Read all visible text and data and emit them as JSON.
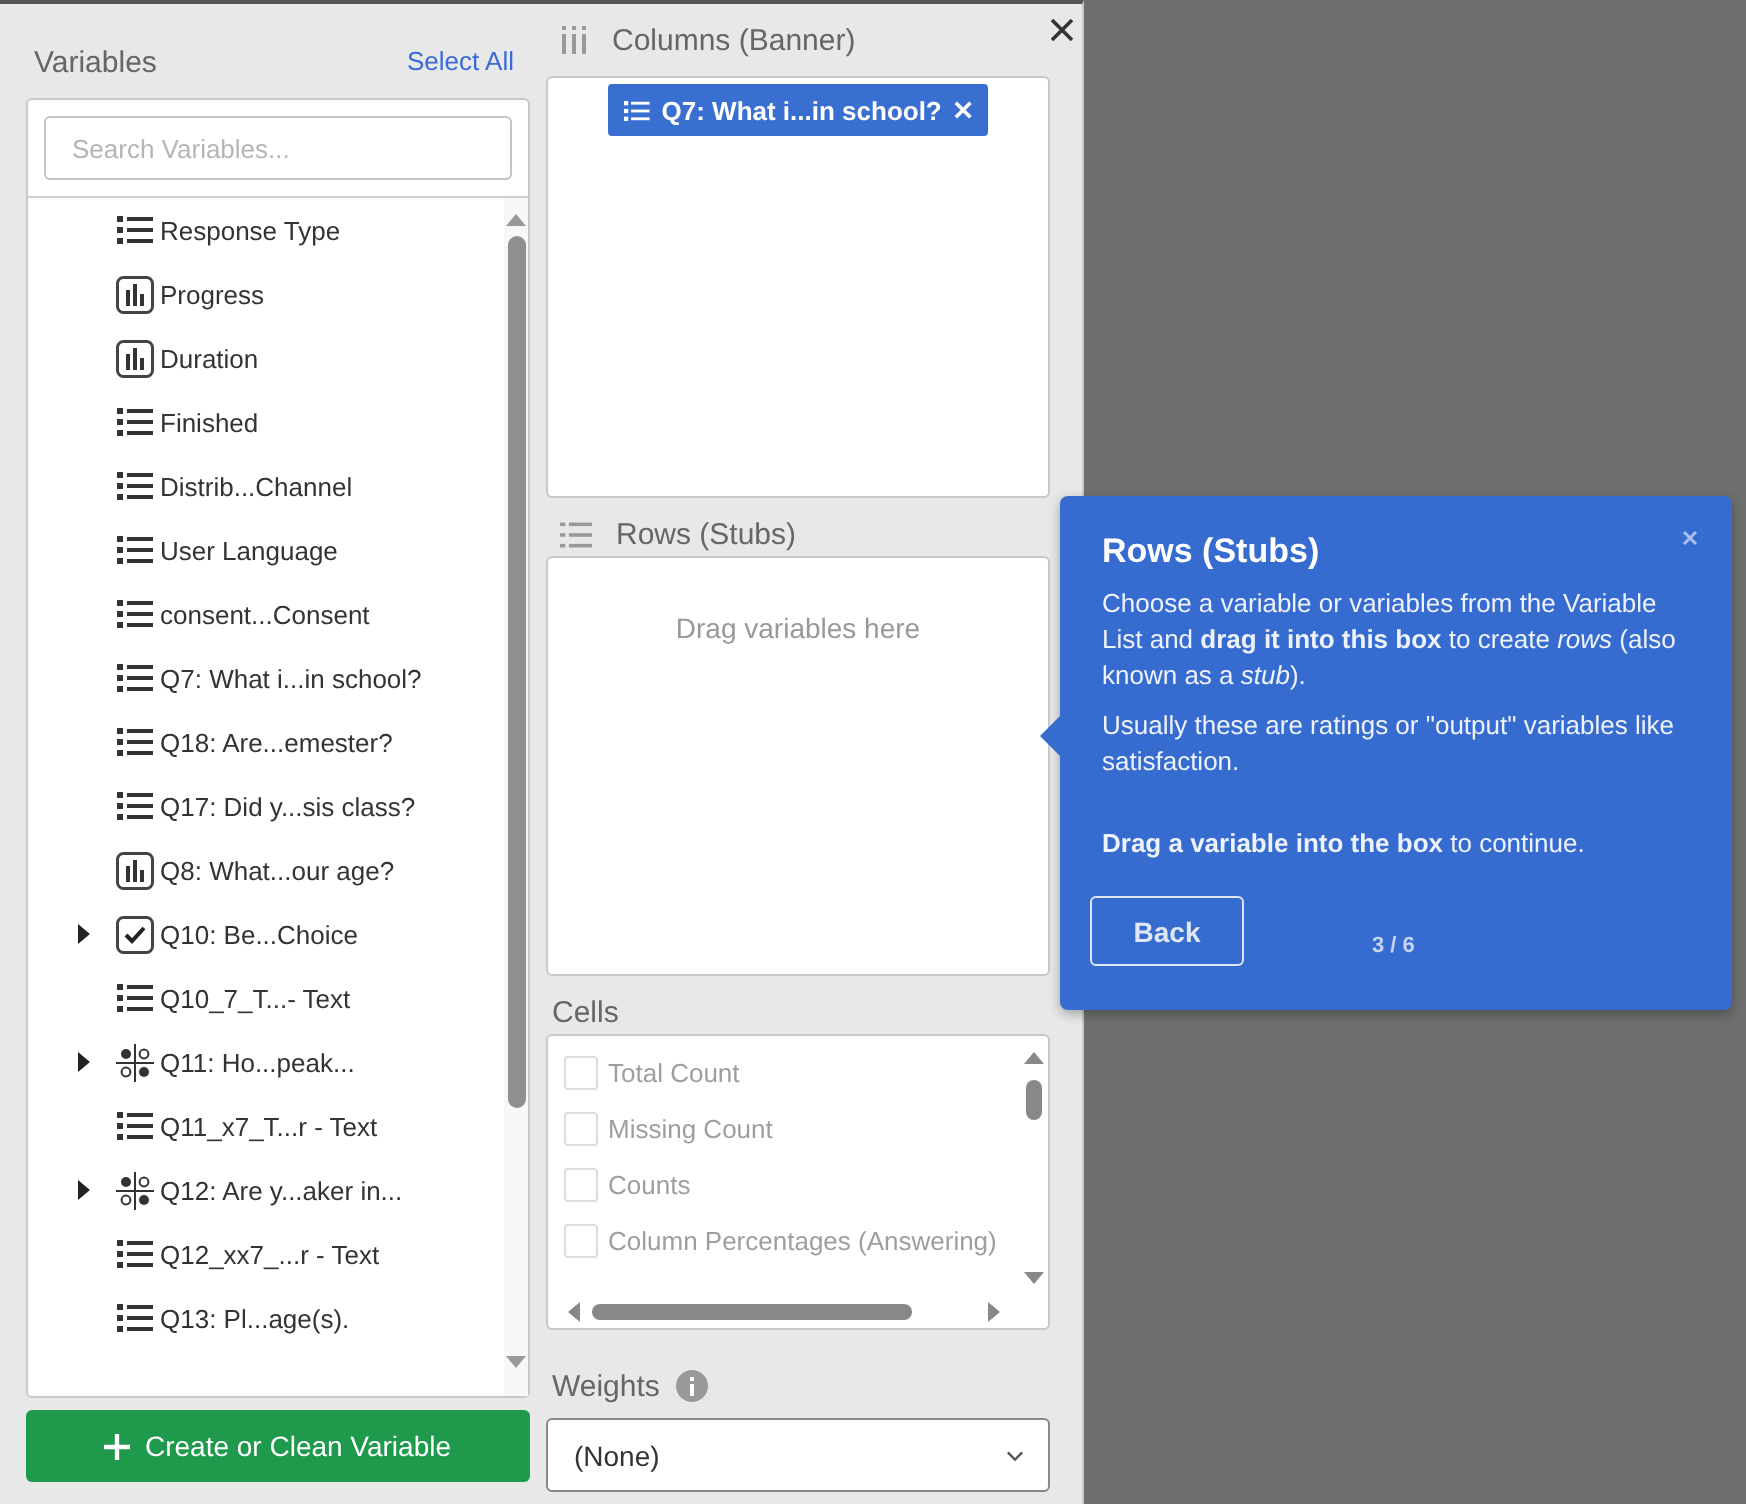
{
  "variables": {
    "title": "Variables",
    "select_all": "Select All",
    "search": {
      "placeholder": "Search Variables..."
    },
    "items": [
      {
        "kind": "list",
        "label": "Response Type",
        "expandable": false
      },
      {
        "kind": "bar",
        "label": "Progress",
        "expandable": false
      },
      {
        "kind": "bar",
        "label": "Duration",
        "expandable": false
      },
      {
        "kind": "list",
        "label": "Finished",
        "expandable": false
      },
      {
        "kind": "list",
        "label": "Distrib...Channel",
        "expandable": false
      },
      {
        "kind": "list",
        "label": "User Language",
        "expandable": false
      },
      {
        "kind": "list",
        "label": "consent...Consent",
        "expandable": false
      },
      {
        "kind": "list",
        "label": "Q7: What i...in school?",
        "expandable": false
      },
      {
        "kind": "list",
        "label": "Q18: Are...emester?",
        "expandable": false
      },
      {
        "kind": "list",
        "label": "Q17: Did y...sis class?",
        "expandable": false
      },
      {
        "kind": "bar",
        "label": "Q8: What...our age?",
        "expandable": false
      },
      {
        "kind": "check",
        "label": "Q10: Be...Choice",
        "expandable": true
      },
      {
        "kind": "list",
        "label": "Q10_7_T...- Text",
        "expandable": false
      },
      {
        "kind": "matrix",
        "label": "Q11: Ho...peak...",
        "expandable": true
      },
      {
        "kind": "list",
        "label": "Q11_x7_T...r - Text",
        "expandable": false
      },
      {
        "kind": "matrix",
        "label": "Q12: Are y...aker in...",
        "expandable": true
      },
      {
        "kind": "list",
        "label": "Q12_xx7_...r - Text",
        "expandable": false
      },
      {
        "kind": "list",
        "label": "Q13: Pl...age(s).",
        "expandable": false
      }
    ],
    "create_button": "Create or Clean Variable"
  },
  "columns": {
    "title": "Columns (Banner)",
    "chips": [
      {
        "label": "Q7: What i...in school?"
      }
    ]
  },
  "rows": {
    "title": "Rows (Stubs)",
    "placeholder": "Drag variables here"
  },
  "cells": {
    "title": "Cells",
    "items": [
      {
        "label": "Total Count",
        "checked": false,
        "disabled": true
      },
      {
        "label": "Missing Count",
        "checked": false,
        "disabled": true
      },
      {
        "label": "Counts",
        "checked": false,
        "disabled": true
      },
      {
        "label": "Column Percentages (Answering)",
        "checked": false,
        "disabled": true
      }
    ]
  },
  "weights": {
    "title": "Weights",
    "value": "(None)"
  },
  "tooltip": {
    "title": "Rows (Stubs)",
    "paragraphs": [
      "Choose a variable or variables from the Variable List and **drag it into this box** to create *rows* (also known as a *stub*).",
      "Usually these are ratings or \"output\" variables like satisfaction.",
      "**Drag a variable into the box** to continue."
    ],
    "back": "Back",
    "step": "3 / 6"
  }
}
